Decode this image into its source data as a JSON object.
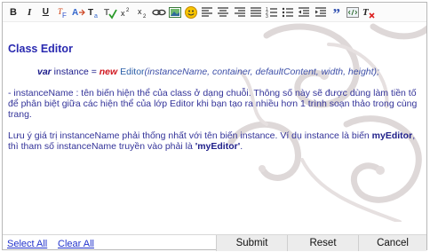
{
  "toolbar": {
    "buttons": [
      {
        "icon": "bold-icon",
        "glyph": "B"
      },
      {
        "icon": "italic-icon",
        "glyph": "I"
      },
      {
        "icon": "underline-icon",
        "glyph": "U"
      },
      {
        "icon": "font-color-icon",
        "glyph": "F"
      },
      {
        "icon": "font-size-icon",
        "glyph": "A"
      },
      {
        "icon": "text-style-icon",
        "glyph": "T"
      },
      {
        "icon": "spellcheck-icon",
        "glyph": "T"
      },
      {
        "icon": "superscript-icon",
        "glyph": "x²"
      },
      {
        "icon": "subscript-icon",
        "glyph": "x₂"
      },
      {
        "icon": "link-icon",
        "glyph": "∞"
      },
      {
        "icon": "image-icon",
        "glyph": ""
      },
      {
        "icon": "emoticon-icon",
        "glyph": ""
      },
      {
        "icon": "align-left-icon",
        "glyph": ""
      },
      {
        "icon": "align-center-icon",
        "glyph": ""
      },
      {
        "icon": "align-right-icon",
        "glyph": ""
      },
      {
        "icon": "align-justify-icon",
        "glyph": ""
      },
      {
        "icon": "ordered-list-icon",
        "glyph": ""
      },
      {
        "icon": "unordered-list-icon",
        "glyph": ""
      },
      {
        "icon": "outdent-icon",
        "glyph": ""
      },
      {
        "icon": "indent-icon",
        "glyph": ""
      },
      {
        "icon": "blockquote-icon",
        "glyph": "”"
      },
      {
        "icon": "view-source-icon",
        "glyph": ""
      },
      {
        "icon": "remove-format-icon",
        "glyph": "T"
      }
    ]
  },
  "editor": {
    "title": "Class Editor",
    "code": {
      "kw_var": "var",
      "instance": " instance = ",
      "kw_new": "new",
      "class_name": " Editor",
      "args": "(instanceName, container, defaultContent, width, height);"
    },
    "para1": "- instanceName : tên biến hiện thể của class ở dạng chuỗi. Thông số này sẽ được dùng làm tiền tố để phân biệt giữa các hiện thể của lớp Editor khi bạn tạo ra nhiều hơn 1 trình soạn thảo trong cùng trang.",
    "para2_a": "Lưu ý giá trị instanceName phải thống nhất với tên biến instance. Ví dụ instance là biến ",
    "para2_b": "myEditor",
    "para2_c": ", thì tham số instanceName truyền vào phải là ",
    "para2_d": "'myEditor'",
    "para2_e": "."
  },
  "footer": {
    "select_all": "Select All",
    "clear_all": "Clear All",
    "submit": "Submit",
    "reset": "Reset",
    "cancel": "Cancel"
  }
}
